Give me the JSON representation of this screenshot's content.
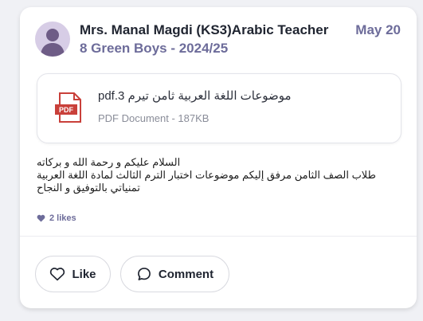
{
  "post": {
    "author": "Mrs. Manal Magdi (KS3)Arabic Teacher",
    "group": "8 Green Boys - 2024/25",
    "date": "May 20",
    "attachment": {
      "icon": "pdf-file-icon",
      "icon_label": "PDF",
      "name": "موضوعات اللغة العربية ثامن تيرم 3.pdf",
      "meta": "PDF Document - 187KB"
    },
    "message_lines": [
      "السلام عليكم و رحمة الله و بركاته",
      "طلاب الصف الثامن مرفق إليكم موضوعات اختبار الترم الثالث لمادة اللغة العربية",
      "تمنياتي بالتوفيق و النجاح"
    ],
    "likes": "2 likes"
  },
  "actions": {
    "like_label": "Like",
    "comment_label": "Comment"
  },
  "colors": {
    "accent": "#6d6c9a",
    "pdf_red": "#c9403a",
    "avatar_bg": "#d7cde6"
  }
}
